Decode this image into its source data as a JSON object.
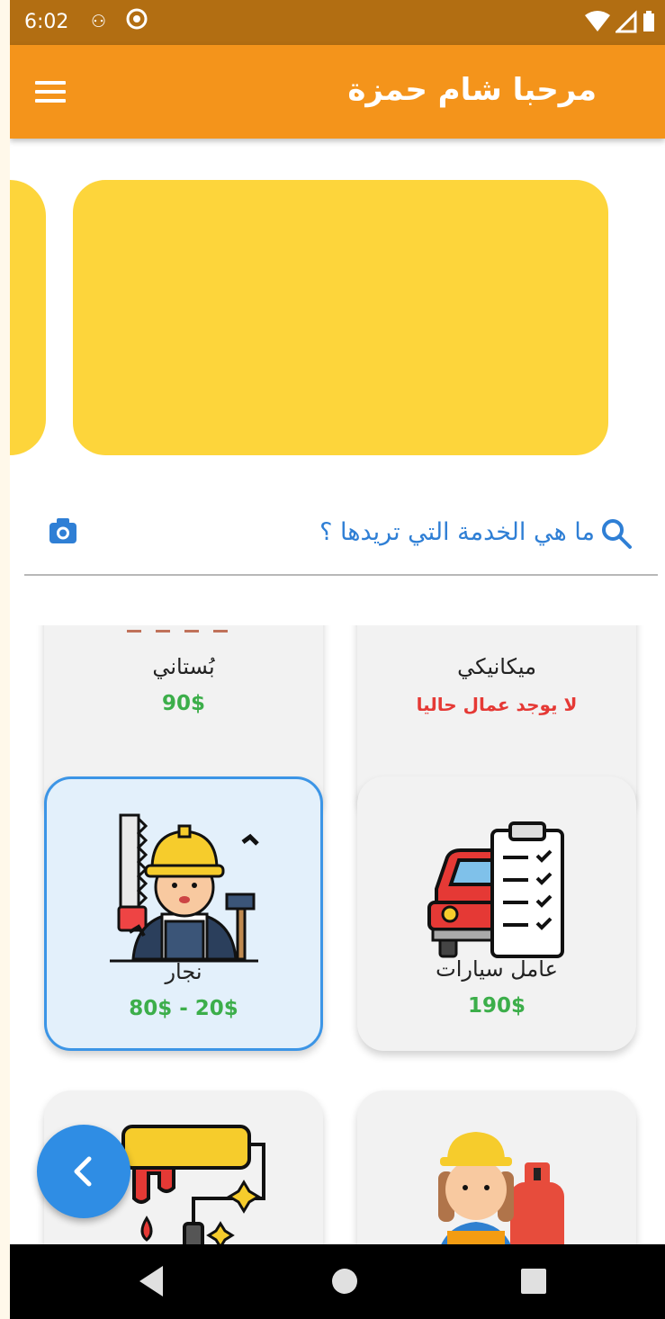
{
  "status_bar": {
    "time": "6:02",
    "icons": [
      "sync-icon",
      "circle-at-icon",
      "wifi-icon",
      "signal-icon",
      "battery-icon"
    ]
  },
  "app_bar": {
    "title": "مرحبا شام حمزة",
    "menu_icon": "menu-icon"
  },
  "search": {
    "placeholder": "ما هي الخدمة التي تريدها ؟",
    "search_icon": "search-icon",
    "camera_icon": "camera-icon"
  },
  "services": [
    {
      "name": "بُستاني",
      "price": "90$"
    },
    {
      "name": "ميكانيكي",
      "status": "لا يوجد عمال حاليا"
    },
    {
      "name": "نجار",
      "price": "80$ - 20$",
      "selected": true
    },
    {
      "name": "عامل سيارات",
      "price": "190$"
    },
    {
      "name": "",
      "icon": "paint-roller-icon"
    },
    {
      "name": "",
      "icon": "gas-worker-icon"
    }
  ],
  "fab": {
    "icon": "chevron-left-icon"
  },
  "nav_bar": {
    "icons": [
      "back-icon",
      "home-icon",
      "recents-icon"
    ]
  },
  "colors": {
    "status_bar": "#b26e12",
    "app_bar": "#f4941b",
    "banner": "#fdd53b",
    "accent": "#2f8de4",
    "price": "#3cae4a",
    "warning": "#e53935"
  }
}
